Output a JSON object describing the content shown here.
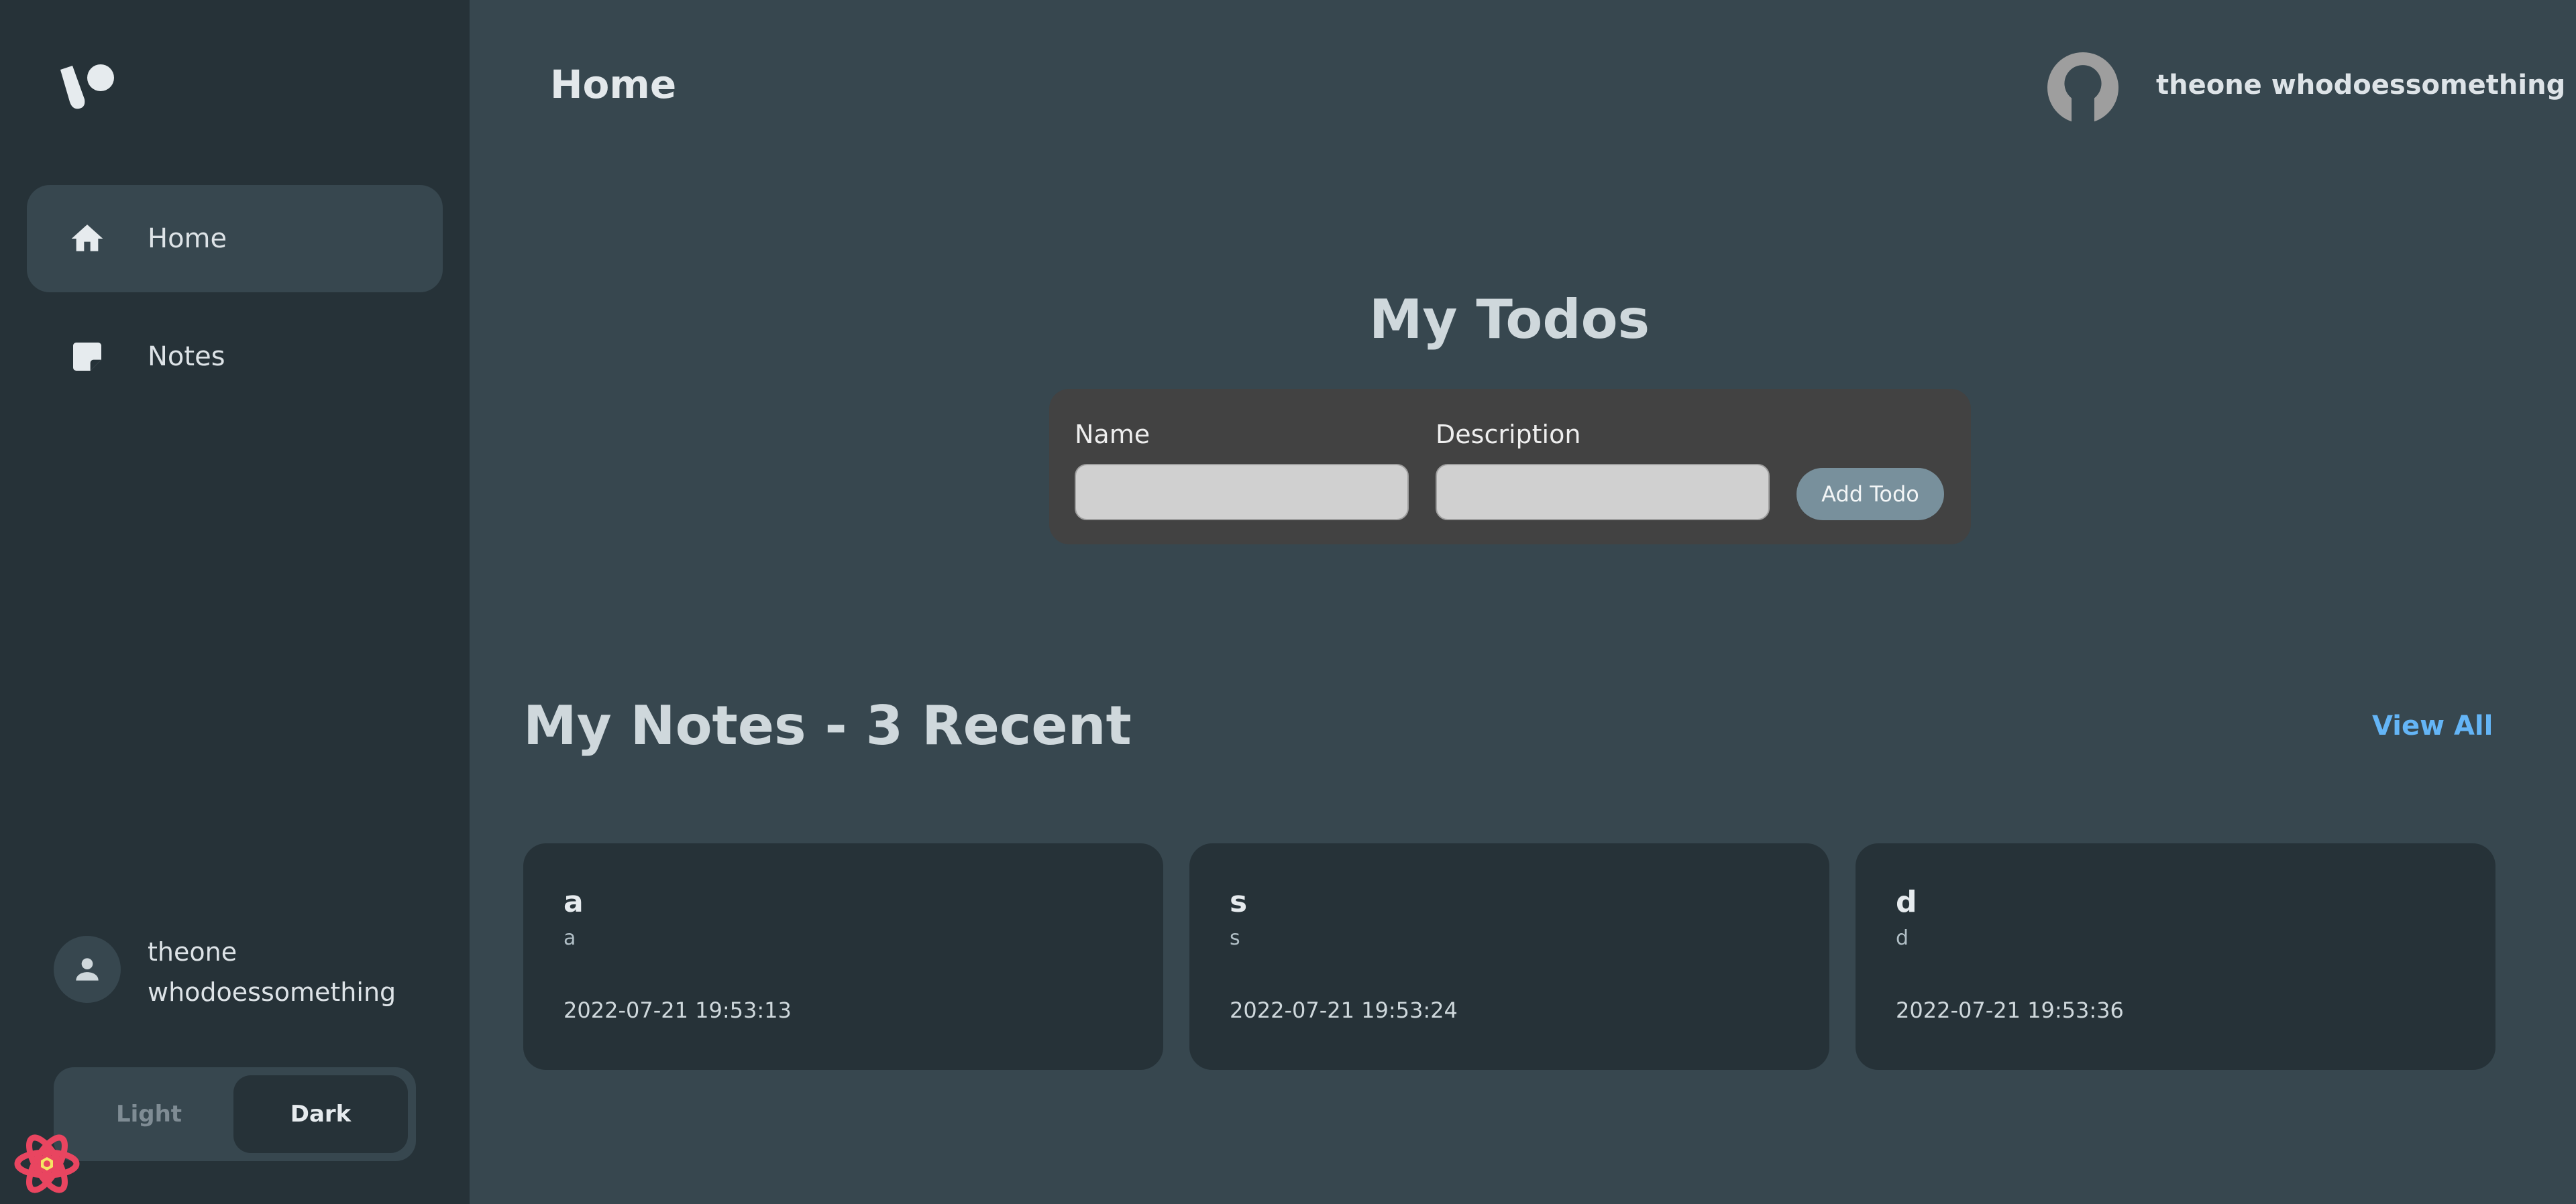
{
  "sidebar": {
    "logo_icon": "brand-logo-icon",
    "nav": [
      {
        "label": "Home",
        "icon": "home-icon",
        "active": true
      },
      {
        "label": "Notes",
        "icon": "note-icon",
        "active": false
      }
    ],
    "user": {
      "name": "theone whodoessomething",
      "icon": "person-icon"
    },
    "theme": {
      "light_label": "Light",
      "dark_label": "Dark",
      "selected": "Dark"
    }
  },
  "header": {
    "title": "Home",
    "user_name": "theone whodoessomething"
  },
  "todos": {
    "title": "My Todos",
    "name_label": "Name",
    "name_value": "",
    "description_label": "Description",
    "description_value": "",
    "add_button": "Add Todo"
  },
  "notes": {
    "title": "My Notes - 3 Recent",
    "view_all": "View All",
    "items": [
      {
        "title": "a",
        "description": "a",
        "date": "2022-07-21 19:53:13"
      },
      {
        "title": "s",
        "description": "s",
        "date": "2022-07-21 19:53:24"
      },
      {
        "title": "d",
        "description": "d",
        "date": "2022-07-21 19:53:36"
      }
    ]
  },
  "colors": {
    "sidebar_bg": "#263238",
    "main_bg": "#37474f",
    "form_bg": "#424242",
    "accent_link": "#64b5f6",
    "button_bg": "#78909c"
  }
}
